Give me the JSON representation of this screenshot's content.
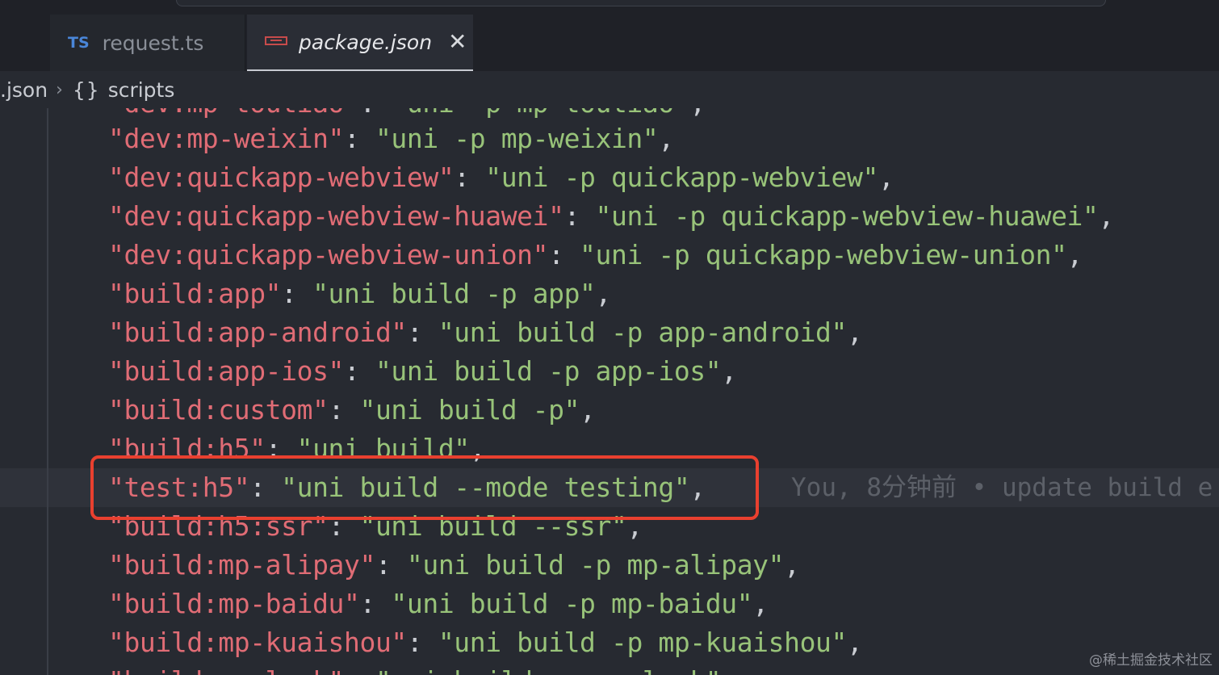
{
  "tabs": [
    {
      "icon": "TS",
      "label": "request.ts",
      "active": false
    },
    {
      "icon": "npm-icon",
      "label": "package.json",
      "active": true,
      "close": "✕"
    }
  ],
  "breadcrumb": {
    "file": ".json",
    "separator": "›",
    "braces": "{}",
    "section": "scripts"
  },
  "code": {
    "lines": [
      {
        "key": "\"dev:mp-toutiao\"",
        "value": "\"uni -p mp-toutiao\"",
        "tail": ","
      },
      {
        "key": "\"dev:mp-weixin\"",
        "value": "\"uni -p mp-weixin\"",
        "tail": ","
      },
      {
        "key": "\"dev:quickapp-webview\"",
        "value": "\"uni -p quickapp-webview\"",
        "tail": ","
      },
      {
        "key": "\"dev:quickapp-webview-huawei\"",
        "value": "\"uni -p quickapp-webview-huawei\"",
        "tail": ","
      },
      {
        "key": "\"dev:quickapp-webview-union\"",
        "value": "\"uni -p quickapp-webview-union\"",
        "tail": ","
      },
      {
        "key": "\"build:app\"",
        "value": "\"uni build -p app\"",
        "tail": ","
      },
      {
        "key": "\"build:app-android\"",
        "value": "\"uni build -p app-android\"",
        "tail": ","
      },
      {
        "key": "\"build:app-ios\"",
        "value": "\"uni build -p app-ios\"",
        "tail": ","
      },
      {
        "key": "\"build:custom\"",
        "value": "\"uni build -p\"",
        "tail": ","
      },
      {
        "key": "\"build:h5\"",
        "value": "\"uni build\"",
        "tail": ","
      },
      {
        "key": "\"test:h5\"",
        "value": "\"uni build --mode testing\"",
        "tail": ","
      },
      {
        "key": "\"build:h5:ssr\"",
        "value": "\"uni build --ssr\"",
        "tail": ","
      },
      {
        "key": "\"build:mp-alipay\"",
        "value": "\"uni build -p mp-alipay\"",
        "tail": ","
      },
      {
        "key": "\"build:mp-baidu\"",
        "value": "\"uni build -p mp-baidu\"",
        "tail": ","
      },
      {
        "key": "\"build:mp-kuaishou\"",
        "value": "\"uni build -p mp-kuaishou\"",
        "tail": ","
      },
      {
        "key": "\"build:mp-lark\"",
        "value": "\"uni build -p mp-lark\"",
        "tail": ","
      }
    ],
    "blame": "You, 8分钟前 • update build e"
  },
  "watermark": "@稀土掘金技术社区",
  "colors": {
    "key": "#e06c75",
    "value": "#98c379",
    "highlight_box": "#e9402f"
  }
}
